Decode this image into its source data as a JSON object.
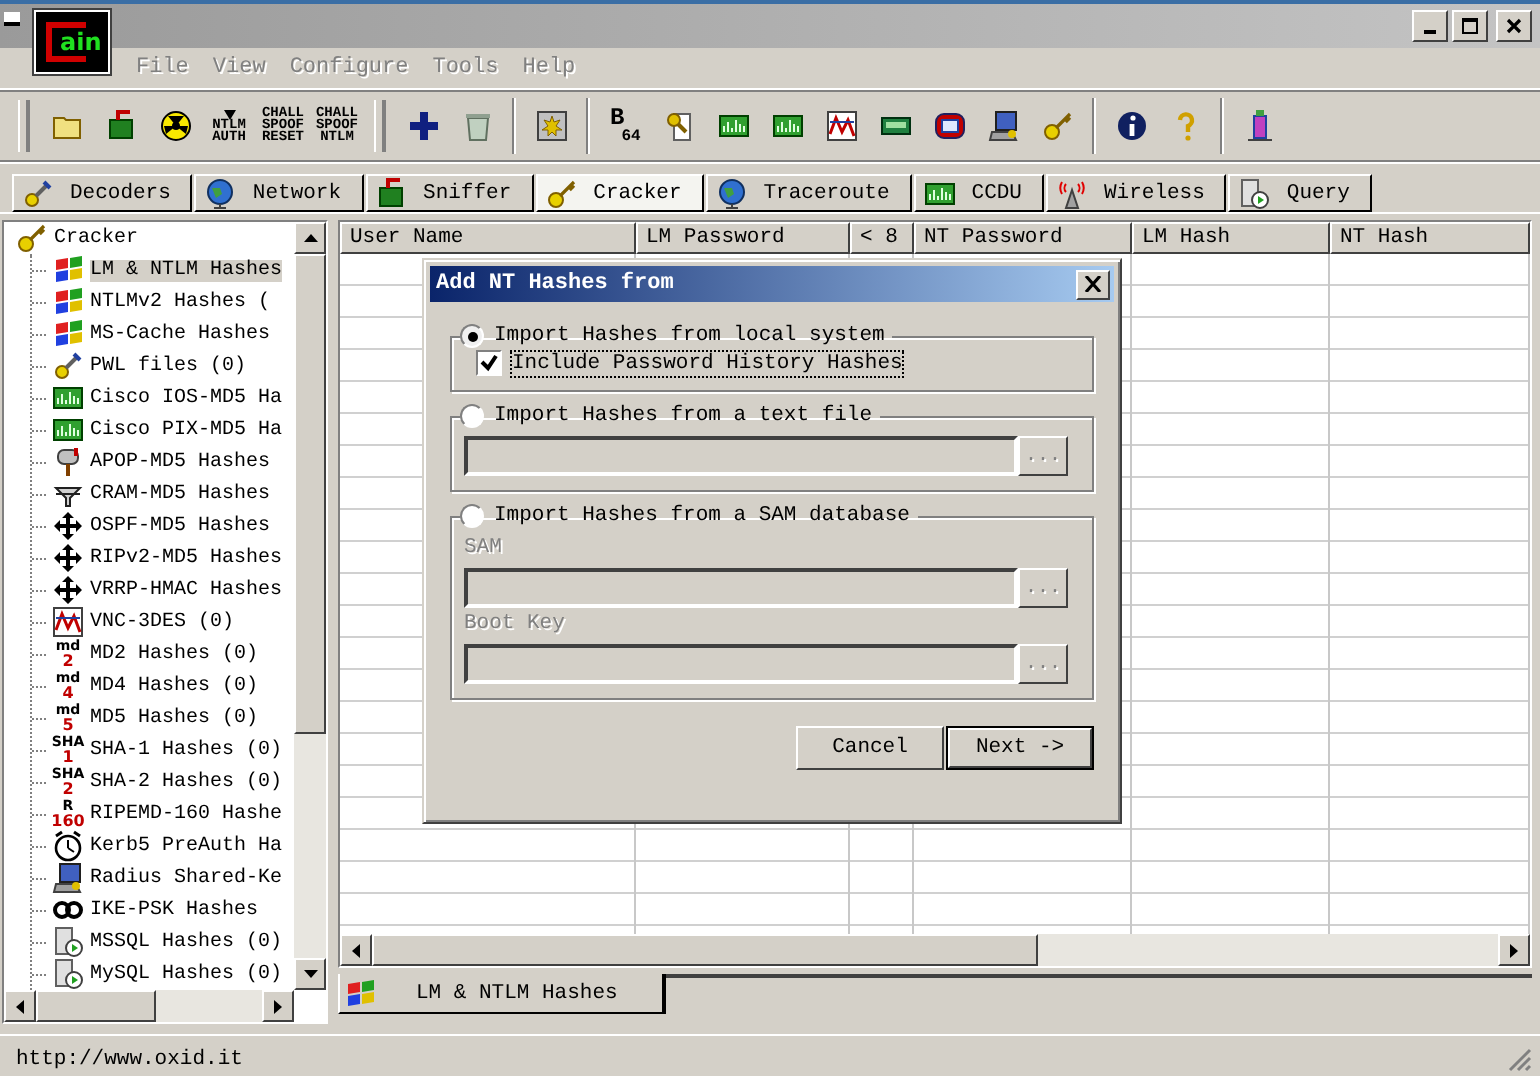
{
  "window": {
    "logo_text": "ain"
  },
  "menu": [
    {
      "label": "File"
    },
    {
      "label": "View"
    },
    {
      "label": "Configure"
    },
    {
      "label": "Tools"
    },
    {
      "label": "Help"
    }
  ],
  "toolbar": [
    {
      "kind": "grip"
    },
    {
      "kind": "folder"
    },
    {
      "kind": "board"
    },
    {
      "kind": "radiation"
    },
    {
      "kind": "text-arrow",
      "lines": [
        "NTLM",
        "AUTH"
      ]
    },
    {
      "kind": "text",
      "lines": [
        "CHALL",
        "SPOOF",
        "RESET"
      ]
    },
    {
      "kind": "text",
      "lines": [
        "CHALL",
        "SPOOF",
        "NTLM"
      ]
    },
    {
      "kind": "grip"
    },
    {
      "kind": "plus"
    },
    {
      "kind": "bin"
    },
    {
      "kind": "sep"
    },
    {
      "kind": "burst"
    },
    {
      "kind": "sep"
    },
    {
      "kind": "text",
      "lines": [
        "B",
        "64"
      ]
    },
    {
      "kind": "keydoc"
    },
    {
      "kind": "meter"
    },
    {
      "kind": "meter"
    },
    {
      "kind": "chart"
    },
    {
      "kind": "card"
    },
    {
      "kind": "tape"
    },
    {
      "kind": "computer"
    },
    {
      "kind": "key"
    },
    {
      "kind": "sep"
    },
    {
      "kind": "info"
    },
    {
      "kind": "help"
    },
    {
      "kind": "sep"
    },
    {
      "kind": "pillar"
    }
  ],
  "tabs": [
    {
      "label": "Decoders",
      "kind": "keys",
      "selected": false
    },
    {
      "label": "Network",
      "kind": "globe",
      "selected": false
    },
    {
      "label": "Sniffer",
      "kind": "board",
      "selected": false
    },
    {
      "label": "Cracker",
      "kind": "key",
      "selected": true
    },
    {
      "label": "Traceroute",
      "kind": "globe",
      "selected": false
    },
    {
      "label": "CCDU",
      "kind": "meter",
      "selected": false
    },
    {
      "label": "Wireless",
      "kind": "antenna",
      "selected": false
    },
    {
      "label": "Query",
      "kind": "db",
      "selected": false
    }
  ],
  "tree": [
    {
      "label": "Cracker",
      "kind": "key",
      "selected": false,
      "children": [
        {
          "label": "LM & NTLM Hashes",
          "kind": "flag",
          "selected": true
        },
        {
          "label": "NTLMv2 Hashes (",
          "kind": "flag",
          "selected": false
        },
        {
          "label": "MS-Cache Hashes",
          "kind": "flag",
          "selected": false
        },
        {
          "label": "PWL files (0)",
          "kind": "keys",
          "selected": false
        },
        {
          "label": "Cisco IOS-MD5 Ha",
          "kind": "meter",
          "selected": false
        },
        {
          "label": "Cisco PIX-MD5 Ha",
          "kind": "meter",
          "selected": false
        },
        {
          "label": "APOP-MD5 Hashes",
          "kind": "mailbox",
          "selected": false
        },
        {
          "label": "CRAM-MD5 Hashes",
          "kind": "funnel",
          "selected": false
        },
        {
          "label": "OSPF-MD5 Hashes",
          "kind": "arrows",
          "selected": false
        },
        {
          "label": "RIPv2-MD5 Hashes",
          "kind": "arrows",
          "selected": false
        },
        {
          "label": "VRRP-HMAC Hashes",
          "kind": "arrows",
          "selected": false
        },
        {
          "label": "VNC-3DES (0)",
          "kind": "chart",
          "selected": false
        },
        {
          "label": "MD2 Hashes (0)",
          "kind": "mark",
          "mark": [
            "md",
            "2"
          ],
          "selected": false
        },
        {
          "label": "MD4 Hashes (0)",
          "kind": "mark",
          "mark": [
            "md",
            "4"
          ],
          "selected": false
        },
        {
          "label": "MD5 Hashes (0)",
          "kind": "mark",
          "mark": [
            "md",
            "5"
          ],
          "selected": false
        },
        {
          "label": "SHA-1 Hashes (0)",
          "kind": "mark",
          "mark": [
            "SHA",
            "1"
          ],
          "selected": false
        },
        {
          "label": "SHA-2 Hashes (0)",
          "kind": "mark",
          "mark": [
            "SHA",
            "2"
          ],
          "selected": false
        },
        {
          "label": "RIPEMD-160 Hashe",
          "kind": "mark",
          "mark": [
            "R",
            "160"
          ],
          "selected": false
        },
        {
          "label": "Kerb5 PreAuth Ha",
          "kind": "clock",
          "selected": false
        },
        {
          "label": "Radius Shared-Ke",
          "kind": "computer",
          "selected": false
        },
        {
          "label": "IKE-PSK Hashes",
          "kind": "ike",
          "selected": false
        },
        {
          "label": "MSSQL Hashes (0)",
          "kind": "db",
          "selected": false
        },
        {
          "label": "MySQL Hashes (0)",
          "kind": "db",
          "selected": false
        }
      ]
    }
  ],
  "table": {
    "columns": [
      "User Name",
      "LM Password",
      "< 8",
      "NT Password",
      "LM Hash",
      "NT Hash"
    ]
  },
  "bottom_tabs": [
    {
      "label": "LM & NTLM Hashes",
      "selected": true
    }
  ],
  "dialog": {
    "title": "Add NT Hashes from",
    "groups": [
      {
        "label": "Import Hashes from local system",
        "selected": true,
        "checkbox": {
          "label": "Include Password History Hashes",
          "checked": true
        }
      },
      {
        "label": "Import Hashes from a text file",
        "selected": false,
        "fields": [
          {
            "button": "...",
            "disabled": true
          }
        ]
      },
      {
        "label": "Import Hashes from a SAM database",
        "selected": false,
        "fields": [
          {
            "label": "SAM",
            "button": "...",
            "disabled": true
          },
          {
            "label": "Boot Key",
            "button": "...",
            "disabled": true
          }
        ]
      }
    ],
    "buttons": [
      {
        "label": "Cancel",
        "default": false
      },
      {
        "label": "Next ->",
        "default": true
      }
    ]
  },
  "status_bar": {
    "text": "http://www.oxid.it"
  }
}
